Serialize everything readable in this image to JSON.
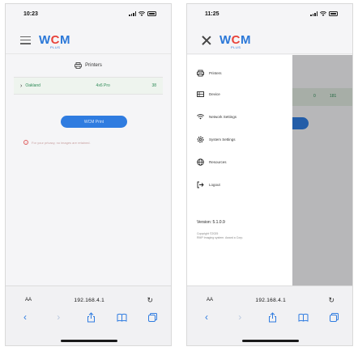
{
  "left_phone": {
    "status_time": "10:23",
    "logo": {
      "brand_w": "W",
      "brand_c": "C",
      "brand_m": "M",
      "sub": "PLUS"
    },
    "page_title": "Printers",
    "printer_row": {
      "name": "Oakland",
      "model": "4x6 Pro",
      "count": "38"
    },
    "print_button": "WCM Print",
    "privacy_note": "For your privacy, no images are retained.",
    "url_bar": {
      "aa": "AA",
      "url": "192.168.4.1"
    }
  },
  "right_phone": {
    "status_time": "11:25",
    "logo": {
      "brand_w": "W",
      "brand_c": "C",
      "brand_m": "M",
      "sub": "PLUS"
    },
    "background_values": {
      "left": "0",
      "right": "181"
    },
    "menu": {
      "printers": "Printers",
      "device": "Device",
      "network_settings": "Network Settings",
      "system_settings": "System Settings",
      "resources": "Resources",
      "logout": "Logout"
    },
    "version": "Version: 5.1.0.9",
    "copyright": "Copyright ©2025\nRMP Imaging system. Award a Corp.",
    "url_bar": {
      "aa": "AA",
      "url": "192.168.4.1"
    }
  },
  "colors": {
    "brand_blue": "#2b78d8",
    "brand_red": "#e8433a",
    "button_blue": "#2f7ce0",
    "row_green": "#2e8b57"
  }
}
